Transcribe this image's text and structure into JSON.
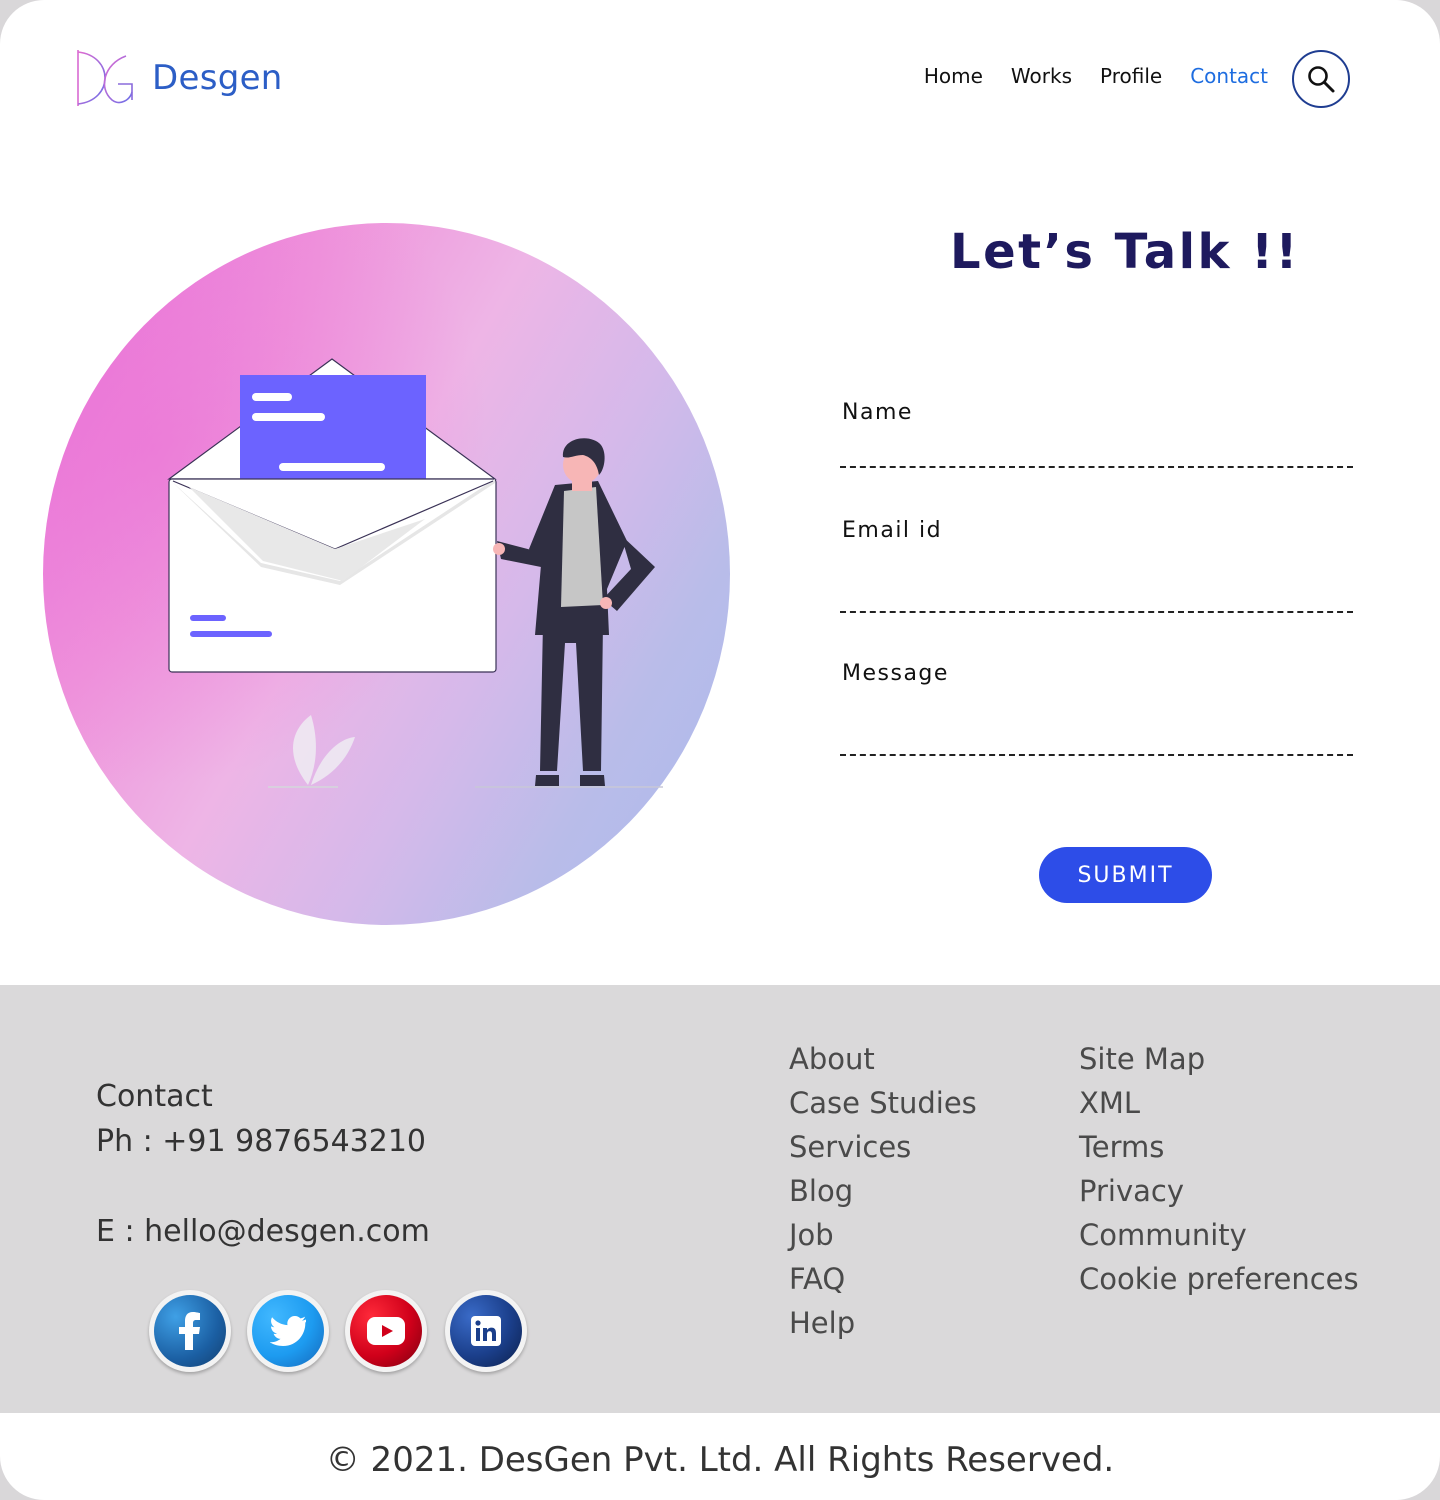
{
  "header": {
    "logo_text": "Desgen",
    "nav": [
      {
        "label": "Home"
      },
      {
        "label": "Works"
      },
      {
        "label": "Profile"
      },
      {
        "label": "Contact",
        "active": true
      }
    ]
  },
  "form": {
    "title": "Let’s Talk !!",
    "fields": {
      "name": {
        "label": "Name",
        "value": ""
      },
      "email": {
        "label": "Email id",
        "value": ""
      },
      "message": {
        "label": "Message",
        "value": ""
      }
    },
    "submit_label": "SUBMIT"
  },
  "footer": {
    "contact": {
      "title": "Contact",
      "phone": "Ph : +91 9876543210",
      "email": "E : hello@desgen.com"
    },
    "social": [
      {
        "icon": "facebook-icon",
        "color": "#1b5fa3"
      },
      {
        "icon": "twitter-icon",
        "color": "#1d9bf0"
      },
      {
        "icon": "youtube-icon",
        "color": "#e0001b"
      },
      {
        "icon": "linkedin-icon",
        "color": "#1b3f8b"
      }
    ],
    "links_col1": [
      "About",
      "Case Studies",
      "Services",
      "Blog",
      "Job",
      "FAQ",
      "Help"
    ],
    "links_col2": [
      "Site Map",
      "XML",
      "Terms",
      "Privacy",
      "Community",
      "Cookie preferences"
    ],
    "copyright": "© 2021. DesGen Pvt. Ltd. All Rights Reserved."
  },
  "colors": {
    "brand": "#2c5ec6",
    "accent": "#2d4de8",
    "title": "#1e1a5e",
    "nav_active": "#1e6de0",
    "footer_bg": "#dad9da"
  }
}
